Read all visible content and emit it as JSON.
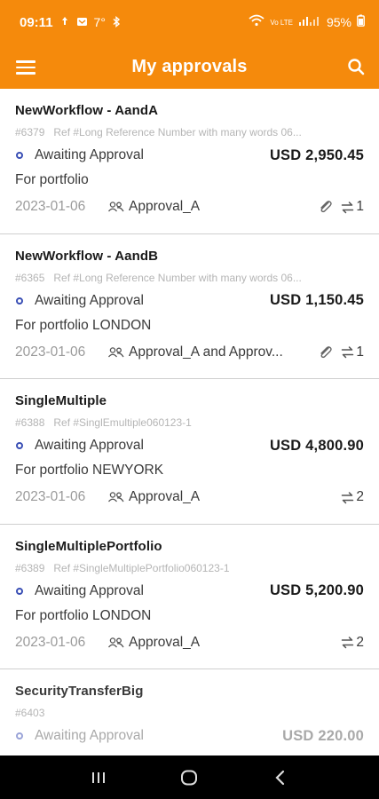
{
  "status_bar": {
    "time": "09:11",
    "temperature": "7°",
    "battery": "95%",
    "network_label": "Vo LTE"
  },
  "header": {
    "title": "My approvals",
    "menu_icon": "hamburger-icon",
    "search_icon": "search-icon",
    "background_color": "#f58a0c"
  },
  "approvals": [
    {
      "title": "NewWorkflow - AandA",
      "id": "#6379",
      "ref": "Ref #Long Reference Number with many words 06...",
      "status": "Awaiting Approval",
      "amount": "USD 2,950.45",
      "portfolio": "For portfolio",
      "date": "2023-01-06",
      "approver": "Approval_A",
      "has_attachment": true,
      "transfer_count": "1"
    },
    {
      "title": "NewWorkflow - AandB",
      "id": "#6365",
      "ref": "Ref #Long Reference Number with many words 06...",
      "status": "Awaiting Approval",
      "amount": "USD 1,150.45",
      "portfolio": "For portfolio LONDON",
      "date": "2023-01-06",
      "approver": "Approval_A and Approv...",
      "has_attachment": true,
      "transfer_count": "1"
    },
    {
      "title": "SingleMultiple",
      "id": "#6388",
      "ref": "Ref #SinglEmultiple060123-1",
      "status": "Awaiting Approval",
      "amount": "USD 4,800.90",
      "portfolio": "For portfolio NEWYORK",
      "date": "2023-01-06",
      "approver": "Approval_A",
      "has_attachment": false,
      "transfer_count": "2"
    },
    {
      "title": "SingleMultiplePortfolio",
      "id": "#6389",
      "ref": "Ref #SingleMultiplePortfolio060123-1",
      "status": "Awaiting Approval",
      "amount": "USD 5,200.90",
      "portfolio": "For portfolio LONDON",
      "date": "2023-01-06",
      "approver": "Approval_A",
      "has_attachment": false,
      "transfer_count": "2"
    },
    {
      "title": "SecurityTransferBig",
      "id": "#6403",
      "ref": "",
      "status": "Awaiting Approval",
      "amount": "USD 220.00",
      "portfolio": "",
      "date": "",
      "approver": "",
      "has_attachment": false,
      "transfer_count": ""
    }
  ],
  "nav": {
    "recents_icon": "recents-icon",
    "home_icon": "home-icon",
    "back_icon": "back-icon"
  }
}
